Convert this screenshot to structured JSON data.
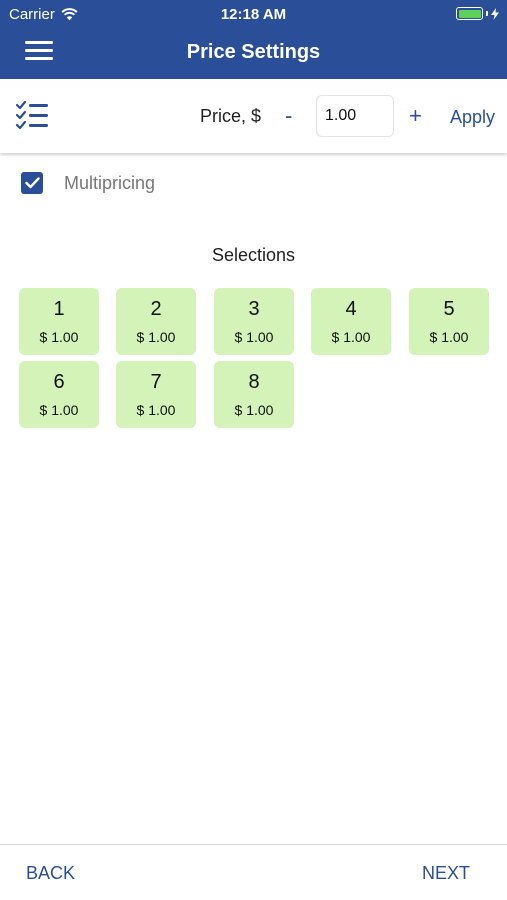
{
  "status_bar": {
    "carrier": "Carrier",
    "time": "12:18 AM",
    "icons": [
      "wifi-icon",
      "battery-icon",
      "charging-bolt-icon"
    ]
  },
  "header": {
    "title": "Price Settings",
    "menu_icon": "hamburger-menu-icon",
    "background": "#2a4f98"
  },
  "toolbar": {
    "list_icon": "checklist-icon",
    "price_label": "Price, $",
    "minus": "-",
    "price_value": "1.00",
    "plus": "+",
    "apply": "Apply"
  },
  "multipricing": {
    "label": "Multipricing",
    "checked": true
  },
  "selections": {
    "title": "Selections",
    "tile_color": "#d3f3b9",
    "items": [
      {
        "number": "1",
        "price": "$ 1.00"
      },
      {
        "number": "2",
        "price": "$ 1.00"
      },
      {
        "number": "3",
        "price": "$ 1.00"
      },
      {
        "number": "4",
        "price": "$ 1.00"
      },
      {
        "number": "5",
        "price": "$ 1.00"
      },
      {
        "number": "6",
        "price": "$ 1.00"
      },
      {
        "number": "7",
        "price": "$ 1.00"
      },
      {
        "number": "8",
        "price": "$ 1.00"
      }
    ]
  },
  "footer": {
    "back": "BACK",
    "next": "NEXT"
  },
  "accent_color": "#2a4f98"
}
